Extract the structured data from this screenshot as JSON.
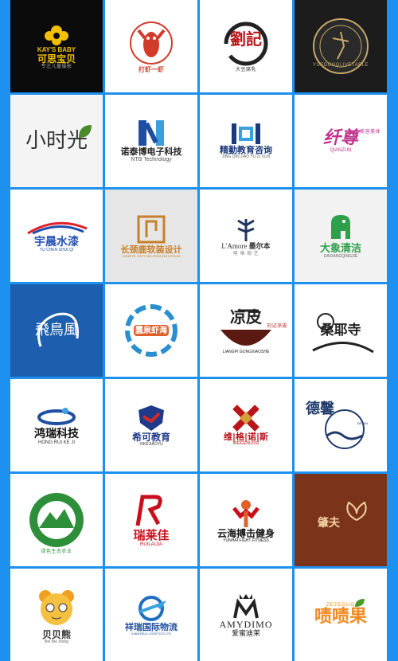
{
  "logos": [
    {
      "name": "kays-baby",
      "en": "KAY'S BABY",
      "cn": "可思宝贝",
      "sub": "专注儿童摄影",
      "bg": "#0b0b0b"
    },
    {
      "name": "daxia-yixia",
      "cn": "打虾一虾",
      "bg": "#ffffff"
    },
    {
      "name": "liu-ji",
      "cn": "劉記",
      "sub": "大豆腐乳",
      "bg": "#ffffff"
    },
    {
      "name": "yuedong-gold",
      "sub": "YUEDONGLIVETABLE",
      "bg": "#1c1c1c"
    },
    {
      "name": "xiao-shi-guang",
      "cn": "小时光",
      "bg": "#f4f4f4"
    },
    {
      "name": "nuotai-bo",
      "cn": "诺泰博电子科技",
      "en": "NTB Technology",
      "bg": "#ffffff"
    },
    {
      "name": "jingqin-edu",
      "cn": "精勤教育咨询",
      "en": "JING QIN JIAO YU ZI XUN",
      "bg": "#ffffff"
    },
    {
      "name": "qianzun",
      "cn": "纤尊",
      "en": "QIANZUN",
      "sub": "美容美体",
      "bg": "#ffffff"
    },
    {
      "name": "yuchen-water",
      "cn": "宇晨水漆",
      "en": "YU CHEN SHUI QI",
      "bg": "#ffffff"
    },
    {
      "name": "changjinglu",
      "cn": "长颈鹿软装设计",
      "en": "GIRAFFE SOFT DECORATION DESIGN",
      "bg": "#e6e6e6"
    },
    {
      "name": "lamore",
      "en": "L'Amore",
      "cn": "墨尔本",
      "sub": "喀 琳 阁 艺",
      "bg": "#ffffff"
    },
    {
      "name": "daxiang-clean",
      "cn": "大象清洁",
      "en": "DAXIANGQINGJIE",
      "bg": "#f2f2f2"
    },
    {
      "name": "feiniao",
      "cn": "飛鳥風",
      "bg": "#1d5fae"
    },
    {
      "name": "chunquan-shrimp",
      "cn": "蠢泉虾海",
      "bg": "#ffffff"
    },
    {
      "name": "liangpi",
      "cn": "凉皮",
      "sub": "刘记凉皮",
      "en": "LIANGPI GONGXIAOSHE",
      "bg": "#ffffff"
    },
    {
      "name": "yezhi-temple",
      "cn": "桑耶寺",
      "bg": "#ffffff"
    },
    {
      "name": "hongrui",
      "cn": "鸿瑞科技",
      "en": "HONG RUI KE JI",
      "bg": "#ffffff"
    },
    {
      "name": "xike-edu",
      "cn": "希可教育",
      "en": "XIKEJIAOYU",
      "bg": "#ffffff"
    },
    {
      "name": "weigenuosi",
      "cn": "维|格|诺|斯",
      "en": "WEIGENUOSI",
      "bg": "#ffffff"
    },
    {
      "name": "dexin",
      "cn": "德馨",
      "en": "DE XIN",
      "bg": "#ffffff"
    },
    {
      "name": "green-mountain",
      "cn": "绿色生态农业",
      "bg": "#ffffff"
    },
    {
      "name": "ruilaijia",
      "cn": "瑞莱佳",
      "en": "RUILAIJIA",
      "bg": "#ffffff"
    },
    {
      "name": "yunhai-fight",
      "cn": "云海搏击健身",
      "en": "YUNHAI FIGHT FITNESS",
      "bg": "#ffffff"
    },
    {
      "name": "qiaofu",
      "cn": "肇夫",
      "bg": "#7b3419"
    },
    {
      "name": "beibei-xiong",
      "cn": "贝贝熊",
      "en": "Bei Bei Xiong",
      "bg": "#ffffff"
    },
    {
      "name": "xiangrui-logistics",
      "cn": "祥瑞国际物流",
      "en": "XIANGRUI LOGISTICS LTD",
      "bg": "#ffffff"
    },
    {
      "name": "amydimo",
      "en": "AMYDIMO",
      "cn": "爱蜜迪茉",
      "bg": "#ffffff"
    },
    {
      "name": "zeze-guo",
      "cn": "啧啧果",
      "en": "ZEZEGUO",
      "bg": "#ffffff"
    }
  ]
}
